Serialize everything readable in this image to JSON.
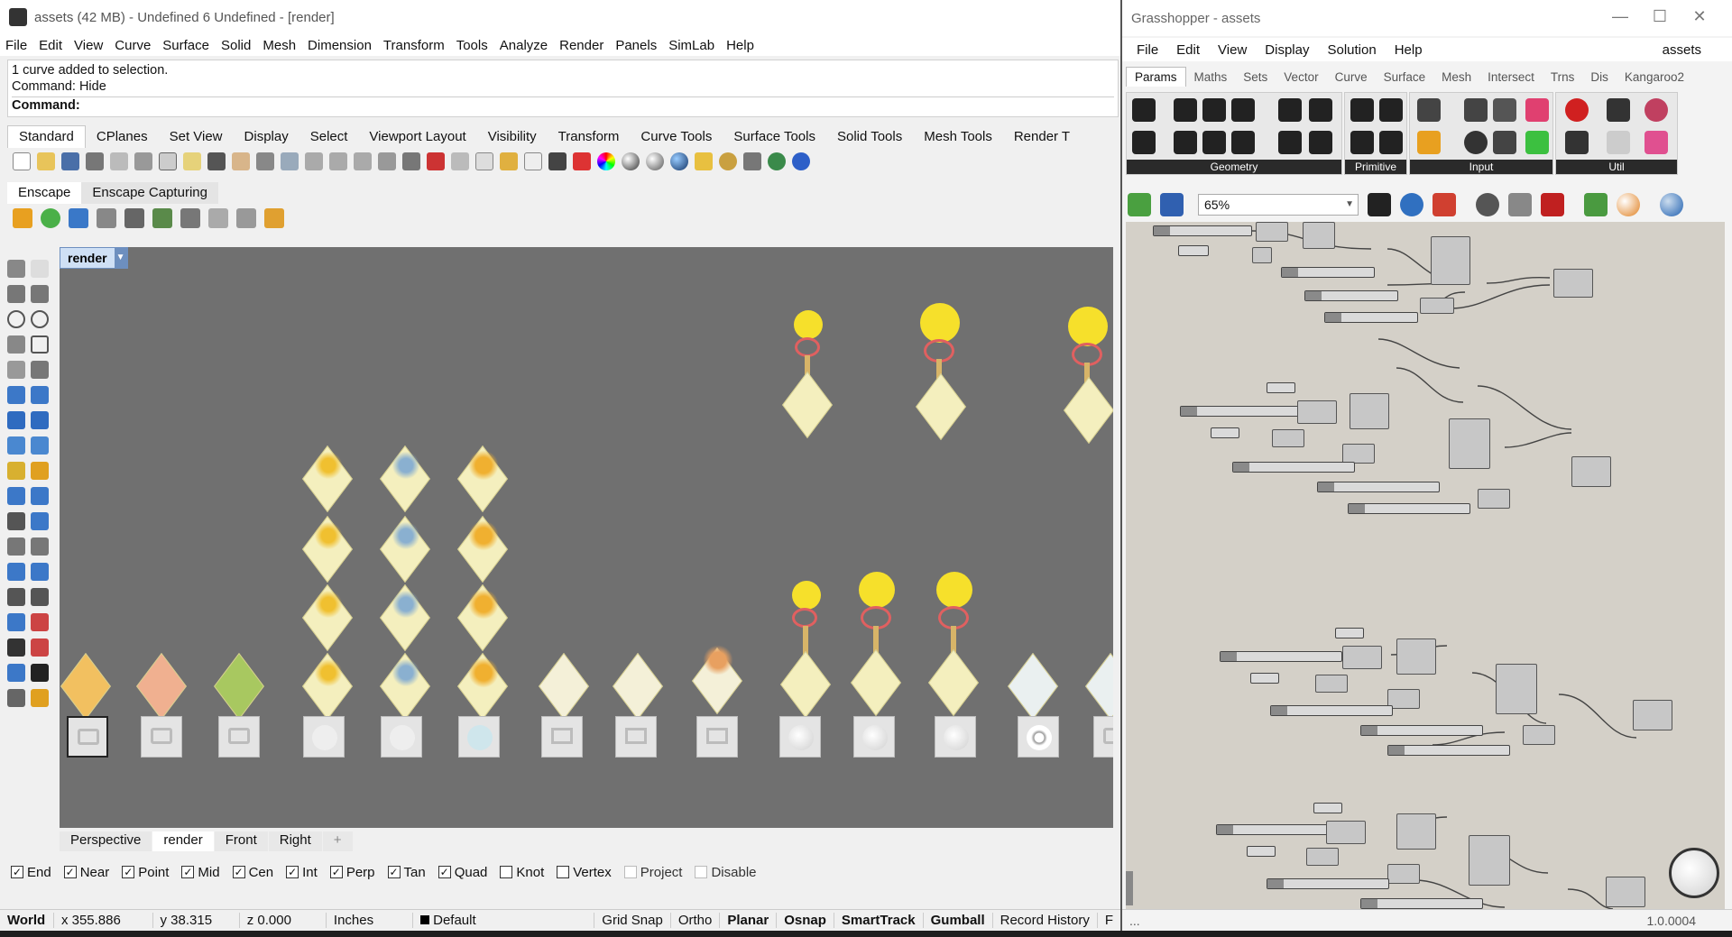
{
  "rhino": {
    "title": "assets (42 MB) - Undefined 6 Undefined - [render]",
    "menu": [
      "File",
      "Edit",
      "View",
      "Curve",
      "Surface",
      "Solid",
      "Mesh",
      "Dimension",
      "Transform",
      "Tools",
      "Analyze",
      "Render",
      "Panels",
      "SimLab",
      "Help"
    ],
    "command_history": [
      "1 curve added to selection.",
      "Command: Hide"
    ],
    "command_prompt": "Command:",
    "toolbar_tabs": [
      "Standard",
      "CPlanes",
      "Set View",
      "Display",
      "Select",
      "Viewport Layout",
      "Visibility",
      "Transform",
      "Curve Tools",
      "Surface Tools",
      "Solid Tools",
      "Mesh Tools",
      "Render T"
    ],
    "plugin_tabs": [
      "Enscape",
      "Enscape Capturing"
    ],
    "viewport_name": "render",
    "viewport_tabs": [
      "Perspective",
      "render",
      "Front",
      "Right"
    ],
    "osnaps": [
      {
        "label": "End",
        "checked": true
      },
      {
        "label": "Near",
        "checked": true
      },
      {
        "label": "Point",
        "checked": true
      },
      {
        "label": "Mid",
        "checked": true
      },
      {
        "label": "Cen",
        "checked": true
      },
      {
        "label": "Int",
        "checked": true
      },
      {
        "label": "Perp",
        "checked": true
      },
      {
        "label": "Tan",
        "checked": true
      },
      {
        "label": "Quad",
        "checked": true
      },
      {
        "label": "Knot",
        "checked": false
      },
      {
        "label": "Vertex",
        "checked": false
      },
      {
        "label": "Project",
        "checked": false
      },
      {
        "label": "Disable",
        "checked": false
      }
    ],
    "status": {
      "cplane": "World",
      "x": "x 355.886",
      "y": "y 38.315",
      "z": "z 0.000",
      "units": "Inches",
      "layer": "Default",
      "toggles": [
        "Grid Snap",
        "Ortho",
        "Planar",
        "Osnap",
        "SmartTrack",
        "Gumball",
        "Record History",
        "F"
      ]
    }
  },
  "grasshopper": {
    "title": "Grasshopper - assets",
    "menu": [
      "File",
      "Edit",
      "View",
      "Display",
      "Solution",
      "Help"
    ],
    "document": "assets",
    "tabs": [
      "Params",
      "Maths",
      "Sets",
      "Vector",
      "Curve",
      "Surface",
      "Mesh",
      "Intersect",
      "Trns",
      "Dis",
      "Kangaroo2"
    ],
    "groups": [
      "Geometry",
      "Primitive",
      "Input",
      "Util"
    ],
    "zoom": "65%",
    "status_left": "...",
    "version": "1.0.0004"
  },
  "colors": {
    "viewport_bg": "#707070",
    "gh_canvas": "#d4d0c8",
    "bulb": "#f6e02b",
    "plate": "#f4efbe"
  }
}
